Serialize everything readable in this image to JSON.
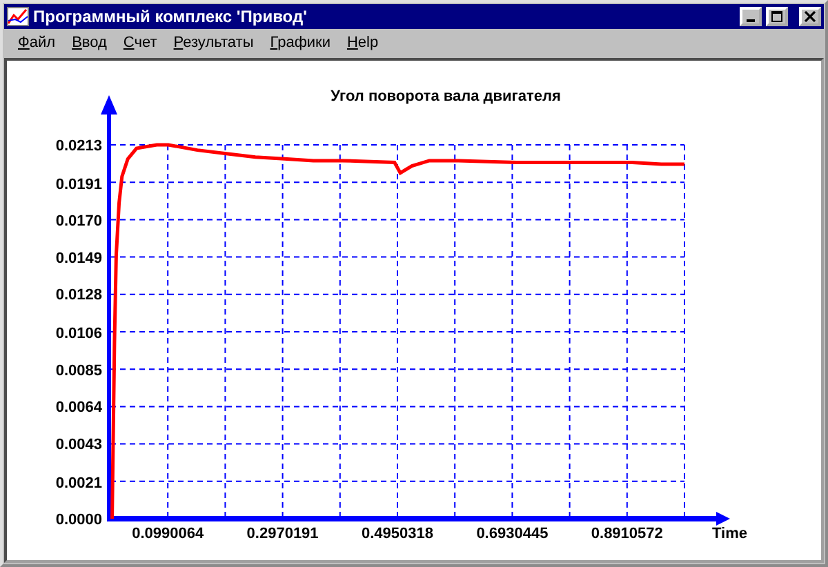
{
  "window": {
    "title": "Программный комплекс 'Привод'"
  },
  "menu": [
    "Файл",
    "Ввод",
    "Счет",
    "Результаты",
    "Графики",
    "Help"
  ],
  "chart": {
    "chart_data": {
      "type": "line",
      "title": "Угол поворота вала двигателя",
      "xlabel": "Time",
      "xlim": [
        0,
        0.990064
      ],
      "ylim": [
        0,
        0.0213
      ],
      "grid": true,
      "xticks": [
        {
          "value": 0.0990064,
          "label": "0.0990064"
        },
        {
          "value": 0.2970191,
          "label": "0.2970191"
        },
        {
          "value": 0.4950318,
          "label": "0.4950318"
        },
        {
          "value": 0.6930445,
          "label": "0.6930445"
        },
        {
          "value": 0.8910572,
          "label": "0.8910572"
        }
      ],
      "yticks": [
        {
          "value": 0,
          "label": "0.0000"
        },
        {
          "value": 0.0021,
          "label": "0.0021"
        },
        {
          "value": 0.0043,
          "label": "0.0043"
        },
        {
          "value": 0.0064,
          "label": "0.0064"
        },
        {
          "value": 0.0085,
          "label": "0.0085"
        },
        {
          "value": 0.0106,
          "label": "0.0106"
        },
        {
          "value": 0.0128,
          "label": "0.0128"
        },
        {
          "value": 0.0149,
          "label": "0.0149"
        },
        {
          "value": 0.017,
          "label": "0.0170"
        },
        {
          "value": 0.0191,
          "label": "0.0191"
        },
        {
          "value": 0.0213,
          "label": "0.0213"
        }
      ],
      "x": [
        0.003,
        0.005,
        0.007,
        0.01,
        0.015,
        0.02,
        0.03,
        0.045,
        0.08,
        0.1,
        0.15,
        0.2,
        0.25,
        0.3,
        0.35,
        0.4,
        0.49,
        0.5,
        0.52,
        0.55,
        0.6,
        0.7,
        0.8,
        0.9,
        0.95,
        0.99
      ],
      "series": [
        {
          "color": "#ff0000",
          "values": [
            0,
            0.005,
            0.01,
            0.015,
            0.018,
            0.0195,
            0.0205,
            0.0211,
            0.0213,
            0.0213,
            0.021,
            0.0208,
            0.0206,
            0.0205,
            0.0204,
            0.0204,
            0.0203,
            0.0197,
            0.0201,
            0.0204,
            0.0204,
            0.0203,
            0.0203,
            0.0203,
            0.0202,
            0.0202
          ]
        }
      ]
    }
  }
}
